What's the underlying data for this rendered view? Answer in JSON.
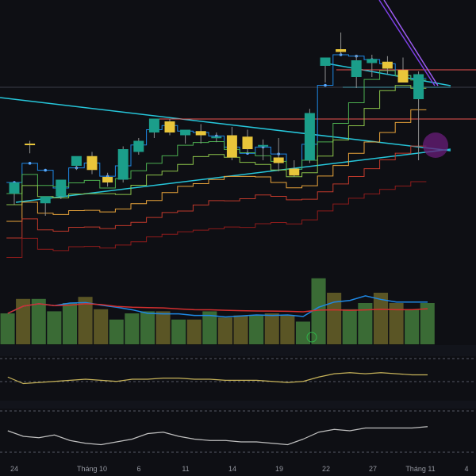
{
  "chart_data": [
    {
      "type": "candlestick",
      "title": "",
      "xlabel": "",
      "ylabel": "",
      "ylim": [
        60,
        140
      ],
      "grid": false,
      "x_ticks": [
        "24",
        "Tháng 10",
        "6",
        "11",
        "14",
        "19",
        "22",
        "27",
        "Tháng 11",
        "4"
      ],
      "candles": [
        {
          "o": 76,
          "h": 79,
          "l": 72,
          "c": 80
        },
        {
          "o": 94,
          "h": 95,
          "l": 90.5,
          "c": 93.8
        },
        {
          "o": 72.5,
          "h": 74,
          "l": 68,
          "c": 75
        },
        {
          "o": 75,
          "h": 76.5,
          "l": 74,
          "c": 81
        },
        {
          "o": 86,
          "h": 88,
          "l": 84.5,
          "c": 89.5
        },
        {
          "o": 89.5,
          "h": 91,
          "l": 83,
          "c": 84.5
        },
        {
          "o": 82,
          "h": 83.5,
          "l": 78.5,
          "c": 80
        },
        {
          "o": 81,
          "h": 93,
          "l": 80,
          "c": 92
        },
        {
          "o": 91,
          "h": 96,
          "l": 90,
          "c": 95
        },
        {
          "o": 98,
          "h": 102,
          "l": 96,
          "c": 103
        },
        {
          "o": 102,
          "h": 103,
          "l": 97,
          "c": 98
        },
        {
          "o": 97,
          "h": 98.5,
          "l": 94,
          "c": 99
        },
        {
          "o": 98.5,
          "h": 101,
          "l": 94,
          "c": 97
        },
        {
          "o": 96,
          "h": 98,
          "l": 94.5,
          "c": 96.5
        },
        {
          "o": 97,
          "h": 100,
          "l": 88,
          "c": 89
        },
        {
          "o": 96.5,
          "h": 99,
          "l": 90.5,
          "c": 92
        },
        {
          "o": 93,
          "h": 95.5,
          "l": 88,
          "c": 93.5
        },
        {
          "o": 89,
          "h": 96,
          "l": 84,
          "c": 87
        },
        {
          "o": 85,
          "h": 88,
          "l": 82,
          "c": 82.5
        },
        {
          "o": 88,
          "h": 106.5,
          "l": 87,
          "c": 105
        },
        {
          "o": 122,
          "h": 124,
          "l": 116,
          "c": 125
        },
        {
          "o": 128,
          "h": 134,
          "l": 126,
          "c": 127
        },
        {
          "o": 118,
          "h": 126,
          "l": 114,
          "c": 124
        },
        {
          "o": 123,
          "h": 126,
          "l": 118,
          "c": 124.5
        },
        {
          "o": 123.5,
          "h": 125.5,
          "l": 119,
          "c": 121
        },
        {
          "o": 120.5,
          "h": 125,
          "l": 117,
          "c": 116
        },
        {
          "o": 110,
          "h": 120,
          "l": 88,
          "c": 119
        }
      ],
      "overlays": {
        "trend_line_color": "#26c6da",
        "level_line_color": "#ef5350",
        "projection_line_color": "#7b3fe4"
      }
    },
    {
      "type": "bar",
      "title": "",
      "series": [
        {
          "values": [
            15,
            22,
            22,
            16,
            20,
            23,
            17,
            12,
            15,
            16,
            16,
            12,
            12,
            16,
            13,
            14,
            14,
            15,
            14,
            11,
            32,
            25,
            17,
            20,
            25,
            20,
            17,
            20
          ]
        }
      ],
      "ylim": [
        0,
        40
      ]
    },
    {
      "type": "line",
      "title": "",
      "series": [
        {
          "values": [
            48,
            42,
            43,
            44,
            45,
            46,
            45,
            44,
            46,
            46,
            47,
            47,
            46,
            46,
            45,
            45,
            45,
            44,
            43,
            44,
            48,
            51,
            52,
            51,
            52,
            51,
            50,
            50
          ]
        }
      ],
      "ylim": [
        30,
        70
      ]
    },
    {
      "type": "line",
      "title": "",
      "series": [
        {
          "values": [
            34,
            30,
            29,
            31,
            27,
            25,
            24,
            26,
            28,
            32,
            33,
            30,
            28,
            27,
            27,
            26,
            26,
            25,
            24,
            28,
            33,
            35,
            34,
            36,
            36,
            36,
            36,
            37
          ]
        }
      ],
      "ylim": [
        10,
        50
      ]
    }
  ],
  "colors": {
    "bull": "#1b9e8a",
    "bear": "#e8c53a",
    "volume_up": "#3a6b35",
    "volume_down": "#5a5525",
    "ma_fast": "#1e88e5",
    "ma_slow": "#d32f2f",
    "rsi": "#c8b45a",
    "stoch": "#c0c0c0"
  }
}
